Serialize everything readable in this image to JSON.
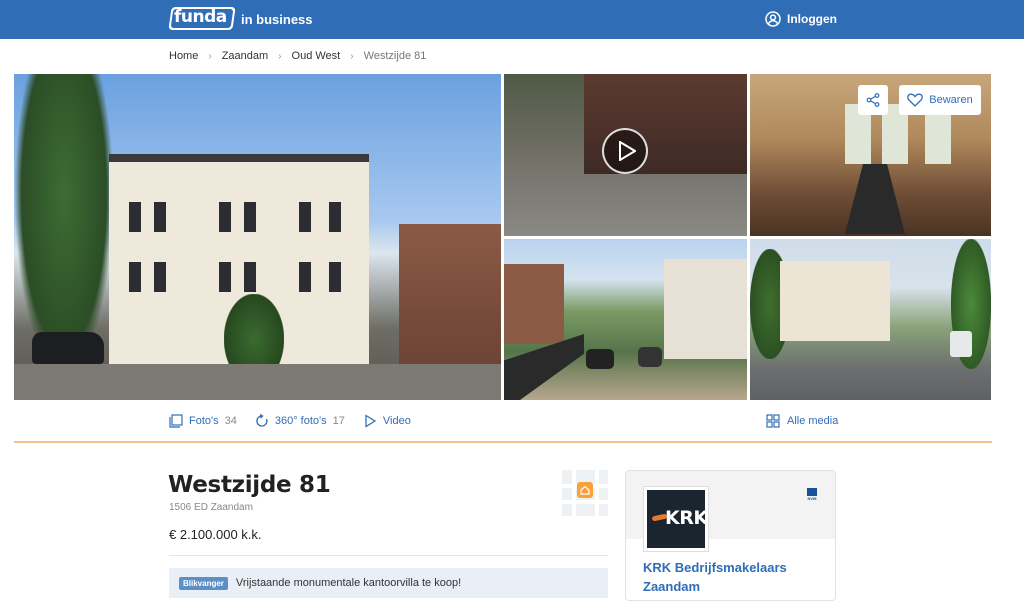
{
  "header": {
    "logo_text": "funda",
    "logo_sub": "in business",
    "login_label": "Inloggen"
  },
  "breadcrumb": [
    {
      "label": "Home"
    },
    {
      "label": "Zaandam"
    },
    {
      "label": "Oud West"
    },
    {
      "label": "Westzijde 81"
    }
  ],
  "gallery": {
    "save_label": "Bewaren"
  },
  "media_bar": {
    "photos_label": "Foto's",
    "photos_count": "34",
    "photos360_label": "360° foto's",
    "photos360_count": "17",
    "video_label": "Video",
    "all_media_label": "Alle media"
  },
  "listing": {
    "title": "Westzijde 81",
    "address": "1506 ED Zaandam",
    "price": "€ 2.100.000 k.k.",
    "blikvanger_badge": "Blikvanger",
    "blikvanger_text": "Vrijstaande monumentale kantoorvilla te koop!"
  },
  "agent": {
    "logo_text": "KRK",
    "nvm_text": "NVM",
    "name": "KRK Bedrijfsmakelaars Zaandam"
  },
  "colors": {
    "brand_blue": "#2f6db6",
    "accent_orange": "#f7a23b",
    "divider_orange": "#f2c08a"
  }
}
